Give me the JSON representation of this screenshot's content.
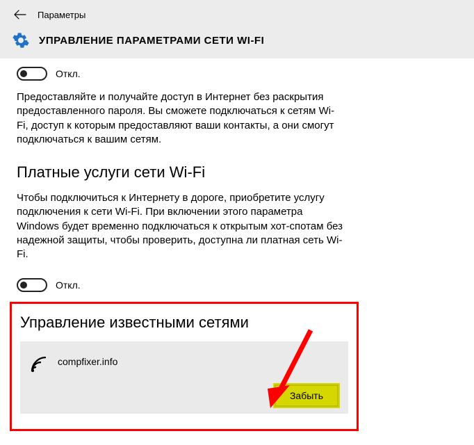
{
  "header": {
    "app_title": "Параметры",
    "page_title": "УПРАВЛЕНИЕ ПАРАМЕТРАМИ СЕТИ WI-FI"
  },
  "share": {
    "toggle_state": "off",
    "toggle_label": "Откл.",
    "description": "Предоставляйте и получайте доступ в Интернет без раскрытия предоставленного пароля. Вы сможете подключаться к сетям Wi-Fi, доступ к которым предоставляют ваши контакты, а они смогут подключаться к вашим сетям."
  },
  "paid": {
    "heading": "Платные услуги сети Wi-Fi",
    "description": "Чтобы подключиться к Интернету в дороге, приобретите услугу подключения к сети Wi-Fi. При включении этого параметра Windows будет временно подключаться к открытым хот-спотам без надежной защиты, чтобы проверить, доступна ли платная сеть Wi-Fi.",
    "toggle_state": "off",
    "toggle_label": "Откл."
  },
  "known": {
    "heading": "Управление известными сетями",
    "networks": [
      {
        "name": "compfixer.info"
      }
    ],
    "forget_label": "Забыть"
  }
}
